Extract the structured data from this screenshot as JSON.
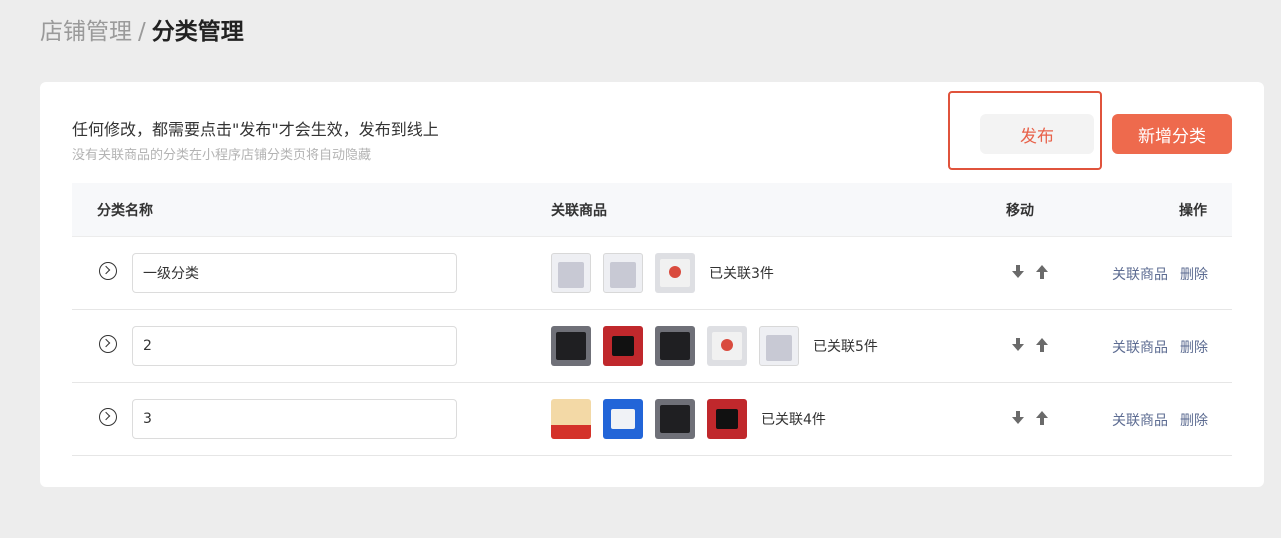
{
  "breadcrumb": {
    "parent": "店铺管理",
    "separator": "/",
    "current": "分类管理"
  },
  "notice": {
    "main": "任何修改，都需要点击\"发布\"才会生效，发布到线上",
    "sub": "没有关联商品的分类在小程序店铺分类页将自动隐藏"
  },
  "actions": {
    "publish_label": "发布",
    "add_label": "新增分类"
  },
  "table": {
    "headers": {
      "name": "分类名称",
      "goods": "关联商品",
      "move": "移动",
      "ops": "操作"
    },
    "rows": [
      {
        "name": "一级分类",
        "linked_text": "已关联3件",
        "thumbs": [
          "white",
          "white",
          "red-card"
        ],
        "op_link": "关联商品",
        "op_delete": "删除"
      },
      {
        "name": "2",
        "linked_text": "已关联5件",
        "thumbs": [
          "black",
          "red",
          "black",
          "red-card",
          "white"
        ],
        "op_link": "关联商品",
        "op_delete": "删除"
      },
      {
        "name": "3",
        "linked_text": "已关联4件",
        "thumbs": [
          "orange",
          "blue",
          "black",
          "red"
        ],
        "op_link": "关联商品",
        "op_delete": "删除"
      }
    ]
  },
  "colors": {
    "accent": "#ee6a4d",
    "publish_text": "#e8624a",
    "highlight_border": "#e0533c",
    "link": "#5d6c92"
  },
  "icons": {
    "expand": "chevron-right-circle-icon",
    "move_down": "arrow-down-icon",
    "move_up": "arrow-up-icon"
  }
}
